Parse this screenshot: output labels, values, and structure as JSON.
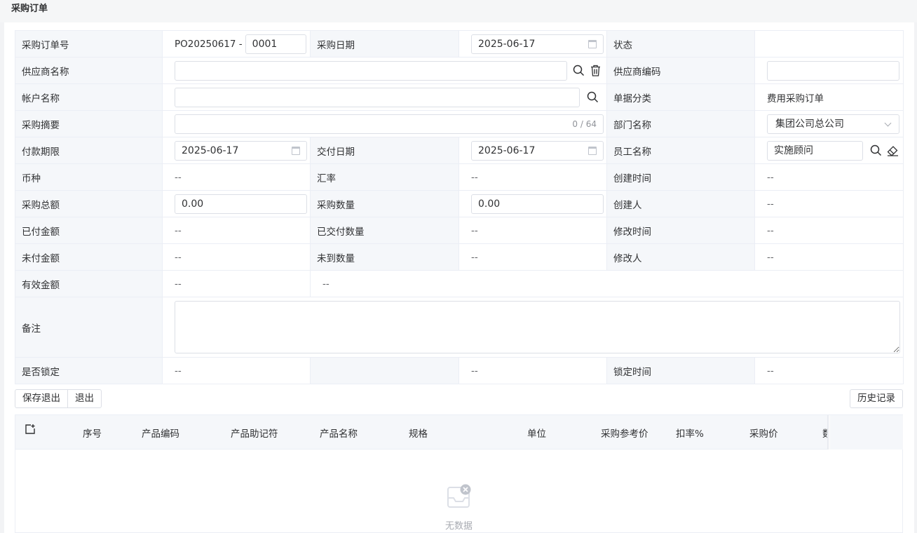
{
  "page": {
    "title": "采购订单"
  },
  "colors": {
    "label_bg": "#f5f7fa",
    "border": "#dcdfe6",
    "placeholder": "#a8abb2"
  },
  "form": {
    "po_no_label": "采购订单号",
    "po_prefix": "PO20250617 -",
    "po_suffix": "0001",
    "po_date_label": "采购日期",
    "po_date": "2025-06-17",
    "status_label": "状态",
    "status": "",
    "supplier_name_label": "供应商名称",
    "supplier_name": "",
    "supplier_code_label": "供应商编码",
    "supplier_code": "",
    "account_label": "帐户名称",
    "account": "",
    "doc_category_label": "单据分类",
    "doc_category": "费用采购订单",
    "summary_label": "采购摘要",
    "summary": "",
    "summary_count": "0 / 64",
    "department_label": "部门名称",
    "department": "集团公司总公司",
    "payment_term_label": "付款期限",
    "payment_term": "2025-06-17",
    "delivery_date_label": "交付日期",
    "delivery_date": "2025-06-17",
    "employee_label": "员工名称",
    "employee": "实施顾问",
    "currency_label": "币种",
    "currency": "--",
    "rate_label": "汇率",
    "rate": "--",
    "created_time_label": "创建时间",
    "created_time": "--",
    "total_amount_label": "采购总额",
    "total_amount": "0.00",
    "quantity_label": "采购数量",
    "quantity": "0.00",
    "creator_label": "创建人",
    "creator": "--",
    "paid_amount_label": "已付金额",
    "paid_amount": "--",
    "delivered_qty_label": "已交付数量",
    "delivered_qty": "--",
    "modified_time_label": "修改时间",
    "modified_time": "--",
    "unpaid_amount_label": "未付金额",
    "unpaid_amount": "--",
    "undelivered_qty_label": "未到数量",
    "undelivered_qty": "--",
    "modifier_label": "修改人",
    "modifier": "--",
    "valid_amount_label": "有效金额",
    "valid_amount": "--",
    "valid_amount_extra": "--",
    "remark_label": "备注",
    "remark": "",
    "locked_label": "是否锁定",
    "locked": "--",
    "locked_extra": "--",
    "lock_time_label": "锁定时间",
    "lock_time": "--"
  },
  "actions": {
    "save_exit": "保存退出",
    "exit": "退出",
    "history": "历史记录"
  },
  "grid": {
    "columns": [
      "序号",
      "产品编码",
      "产品助记符",
      "产品名称",
      "规格",
      "单位",
      "采购参考价",
      "扣率%",
      "采购价",
      "数"
    ],
    "empty_text": "无数据"
  }
}
